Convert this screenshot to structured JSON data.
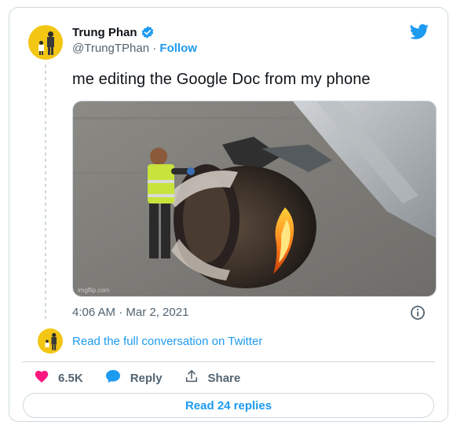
{
  "tweet": {
    "author_name": "Trung Phan",
    "handle": "@TrungTPhan",
    "separator": " · ",
    "follow_label": "Follow",
    "text": "me editing the Google Doc from my phone",
    "timestamp": "4:06 AM · Mar 2, 2021",
    "image_watermark": "imgflip.com",
    "icons": [
      "verified-badge-icon",
      "twitter-bird-icon",
      "info-icon",
      "heart-icon",
      "reply-bubble-icon",
      "share-icon"
    ]
  },
  "conversation": {
    "read_full_label": "Read the full conversation on Twitter"
  },
  "actions": {
    "like_count": "6.5K",
    "reply_label": "Reply",
    "share_label": "Share"
  },
  "footer": {
    "read_replies_label": "Read 24 replies"
  },
  "colors": {
    "accent": "#1d9bf0",
    "heart": "#f91880",
    "avatar_bg": "#f3c614",
    "text_secondary": "#536471",
    "border": "#cfd9de"
  }
}
